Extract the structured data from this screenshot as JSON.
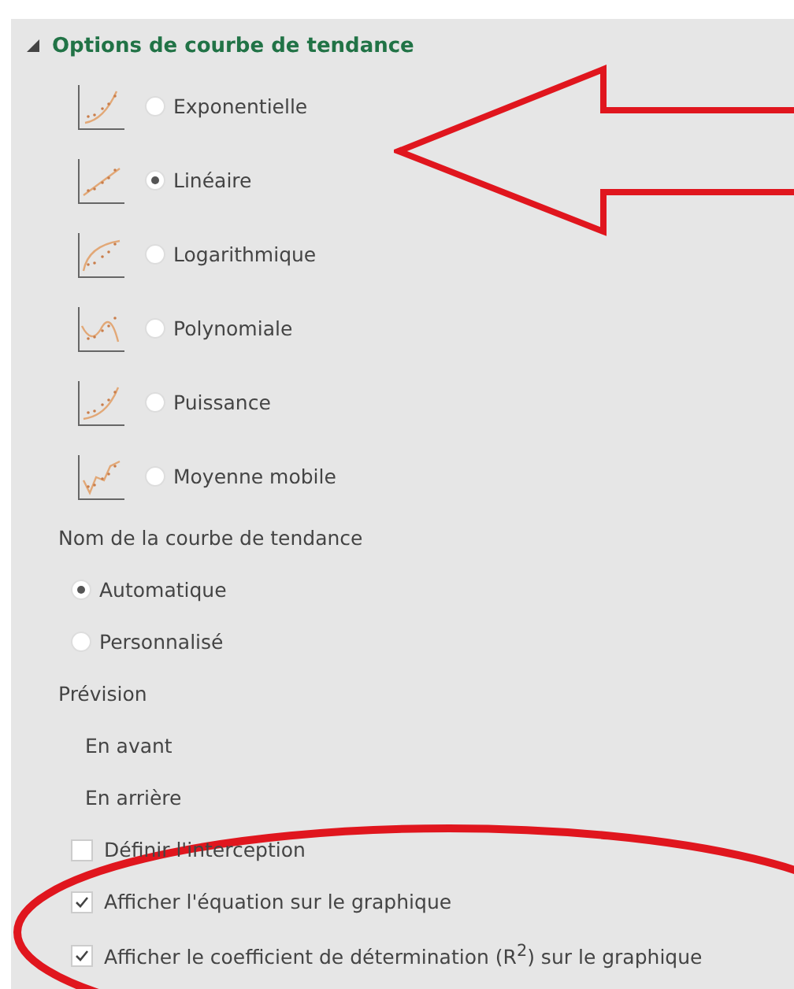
{
  "section": {
    "title": "Options de courbe de tendance",
    "expanded": true
  },
  "trend_types": [
    {
      "kind": "exponential",
      "label": "Exponentielle",
      "selected": false
    },
    {
      "kind": "linear",
      "label": "Linéaire",
      "selected": true
    },
    {
      "kind": "logarithmic",
      "label": "Logarithmique",
      "selected": false
    },
    {
      "kind": "polynomial",
      "label": "Polynomiale",
      "selected": false
    },
    {
      "kind": "power",
      "label": "Puissance",
      "selected": false
    },
    {
      "kind": "moving_average",
      "label": "Moyenne mobile",
      "selected": false
    }
  ],
  "name_group": {
    "label": "Nom de la courbe de tendance",
    "options": [
      {
        "label": "Automatique",
        "selected": true
      },
      {
        "label": "Personnalisé",
        "selected": false
      }
    ]
  },
  "forecast": {
    "label": "Prévision",
    "fields": [
      "En avant",
      "En arrière"
    ]
  },
  "checkboxes": [
    {
      "label": "Définir l'interception",
      "checked": false
    },
    {
      "label": "Afficher l'équation sur le graphique",
      "checked": true
    },
    {
      "label": "Afficher le coefficient de détermination (R$^{2}$) sur le graphique",
      "checked": true
    }
  ]
}
